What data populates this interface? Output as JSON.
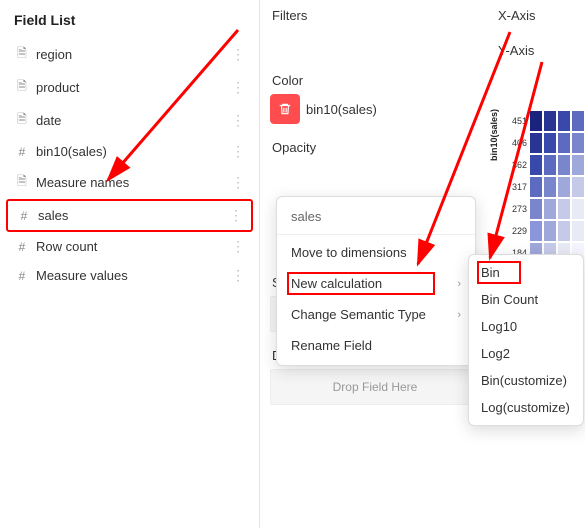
{
  "field_list": {
    "title": "Field List",
    "items": [
      {
        "icon": "doc",
        "label": "region"
      },
      {
        "icon": "doc",
        "label": "product"
      },
      {
        "icon": "doc",
        "label": "date"
      },
      {
        "icon": "hash",
        "label": "bin10(sales)"
      },
      {
        "icon": "doc",
        "label": "Measure names"
      },
      {
        "icon": "hash",
        "label": "sales",
        "highlight": true
      },
      {
        "icon": "hash",
        "label": "Row count"
      },
      {
        "icon": "hash",
        "label": "Measure values"
      }
    ]
  },
  "shelves": {
    "filters_label": "Filters",
    "color_label": "Color",
    "color_pill": "bin10(sales)",
    "opacity_label": "Opacity",
    "shape_label": "Shape",
    "details_label": "Details",
    "drop_placeholder": "Drop Field Here"
  },
  "axes": {
    "x_label": "X-Axis",
    "y_label": "Y-Axis"
  },
  "context_menu": {
    "header": "sales",
    "items": [
      {
        "label": "Move to dimensions"
      },
      {
        "label": "New calculation",
        "has_submenu": true,
        "highlight": true
      },
      {
        "label": "Change Semantic Type",
        "has_submenu": true
      },
      {
        "label": "Rename Field"
      }
    ]
  },
  "submenu": {
    "items": [
      {
        "label": "Bin",
        "highlight": true
      },
      {
        "label": "Bin Count"
      },
      {
        "label": "Log10"
      },
      {
        "label": "Log2"
      },
      {
        "label": "Bin(customize)"
      },
      {
        "label": "Log(customize)"
      }
    ]
  },
  "chart_data": {
    "type": "heatmap",
    "ylabel": "bin10(sales)",
    "y_ticks": [
      451,
      406,
      362,
      317,
      273,
      229,
      184
    ],
    "colors": [
      [
        "#1a237e",
        "#283593",
        "#3949ab",
        "#5c6bc0"
      ],
      [
        "#283593",
        "#3949ab",
        "#5c6bc0",
        "#7986cb"
      ],
      [
        "#3949ab",
        "#5c6bc0",
        "#7986cb",
        "#9fa8da"
      ],
      [
        "#5c6bc0",
        "#7986cb",
        "#9fa8da",
        "#c5cae9"
      ],
      [
        "#7986cb",
        "#9fa8da",
        "#c5cae9",
        "#e8eaf6"
      ],
      [
        "#8b95d9",
        "#9fa8da",
        "#c5cae9",
        "#e8eaf6"
      ],
      [
        "#9fa8da",
        "#c5cae9",
        "#e8eaf6",
        "#f5f5ff"
      ]
    ]
  },
  "icons": {
    "doc": "🗎",
    "hash": "#",
    "trash": "🗑",
    "chevron": "›",
    "dots": "⋮"
  }
}
